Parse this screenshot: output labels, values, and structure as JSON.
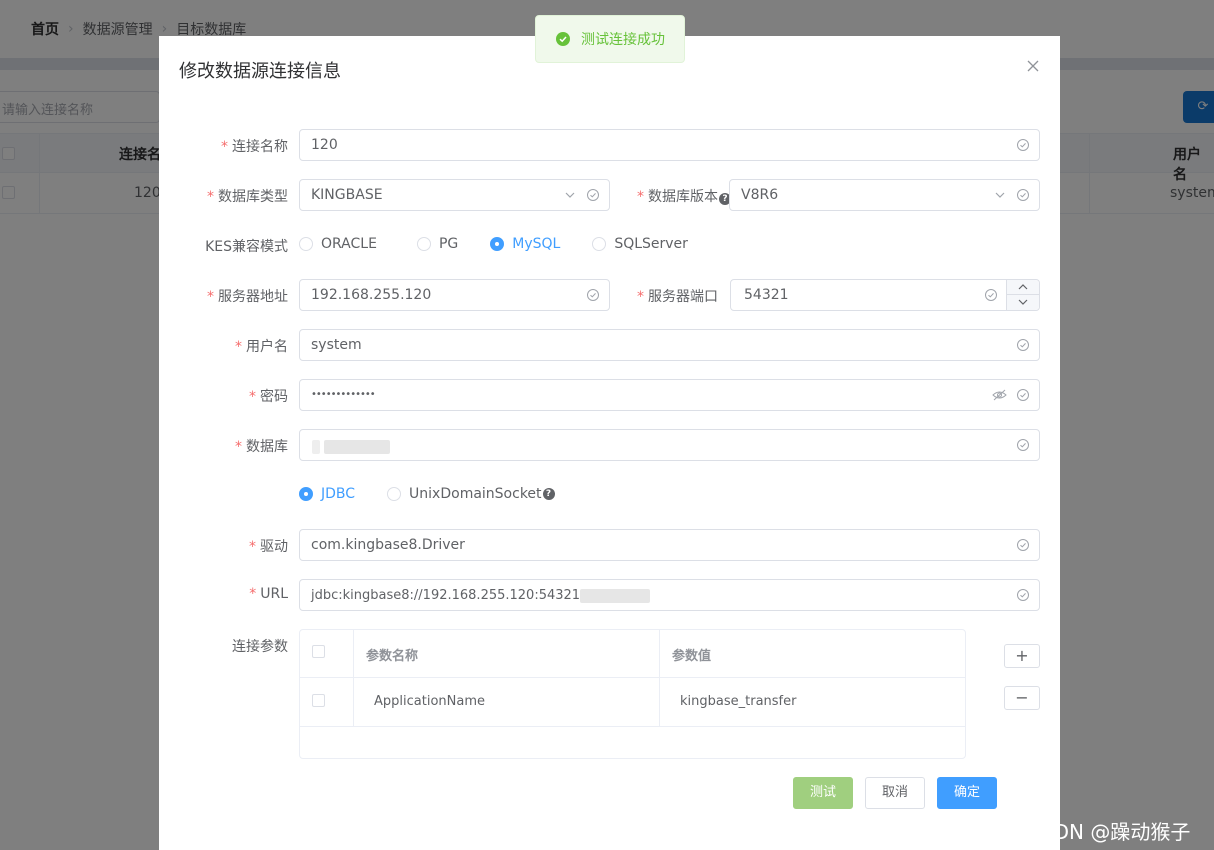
{
  "breadcrumb": [
    "首页",
    "数据源管理",
    "目标数据库"
  ],
  "background": {
    "search_placeholder": "请输入连接名称",
    "table_headers": [
      "连接名",
      "用户名"
    ],
    "row": {
      "name": "120",
      "user": "system"
    }
  },
  "dialog": {
    "title": "修改数据源连接信息",
    "fields": {
      "conn_name": {
        "label": "连接名称",
        "value": "120"
      },
      "db_type": {
        "label": "数据库类型",
        "value": "KINGBASE"
      },
      "db_version": {
        "label": "数据库版本",
        "value": "V8R6"
      },
      "kes_mode": {
        "label": "KES兼容模式",
        "options": [
          "ORACLE",
          "PG",
          "MySQL",
          "SQLServer"
        ],
        "selected": "MySQL"
      },
      "server_addr": {
        "label": "服务器地址",
        "value": "192.168.255.120"
      },
      "server_port": {
        "label": "服务器端口",
        "value": "54321"
      },
      "username": {
        "label": "用户名",
        "value": "system"
      },
      "password": {
        "label": "密码",
        "value": "•••••••••••••"
      },
      "database": {
        "label": "数据库"
      },
      "conn_type": {
        "options": [
          "JDBC",
          "UnixDomainSocket"
        ],
        "selected": "JDBC"
      },
      "driver": {
        "label": "驱动",
        "value": "com.kingbase8.Driver"
      },
      "url": {
        "label": "URL",
        "value": "jdbc:kingbase8://192.168.255.120:54321/"
      },
      "params": {
        "label": "连接参数",
        "headers": [
          "参数名称",
          "参数值"
        ],
        "rows": [
          {
            "name": "ApplicationName",
            "value": "kingbase_transfer"
          }
        ]
      }
    },
    "buttons": {
      "test": "测试",
      "cancel": "取消",
      "confirm": "确定",
      "add": "+",
      "remove": "−"
    }
  },
  "toast": {
    "message": "测试连接成功",
    "color": "#67c23a"
  },
  "watermark": "CSDN @躁动猴子",
  "colors": {
    "primary": "#409eff",
    "success": "#67c23a",
    "danger": "#f56c6c"
  }
}
